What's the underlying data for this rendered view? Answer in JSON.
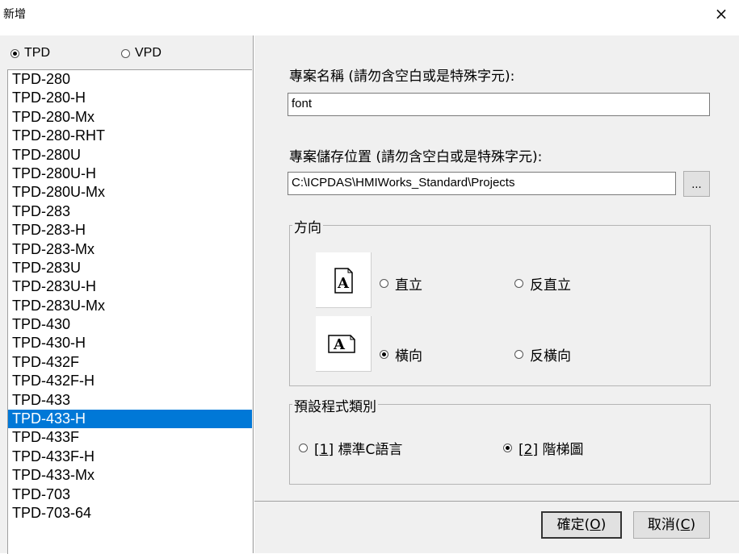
{
  "window": {
    "title": "新增",
    "close_glyph": "×"
  },
  "device_type": {
    "options": [
      {
        "label": "TPD",
        "checked": true
      },
      {
        "label": "VPD",
        "checked": false
      }
    ]
  },
  "model_list": {
    "items": [
      "TPD-280",
      "TPD-280-H",
      "TPD-280-Mx",
      "TPD-280-RHT",
      "TPD-280U",
      "TPD-280U-H",
      "TPD-280U-Mx",
      "TPD-283",
      "TPD-283-H",
      "TPD-283-Mx",
      "TPD-283U",
      "TPD-283U-H",
      "TPD-283U-Mx",
      "TPD-430",
      "TPD-430-H",
      "TPD-432F",
      "TPD-432F-H",
      "TPD-433",
      "TPD-433-H",
      "TPD-433F",
      "TPD-433F-H",
      "TPD-433-Mx",
      "TPD-703",
      "TPD-703-64"
    ],
    "selected": "TPD-433-H"
  },
  "project_name": {
    "label": "專案名稱 (請勿含空白或是特殊字元):",
    "value": "font"
  },
  "project_path": {
    "label": "專案儲存位置 (請勿含空白或是特殊字元):",
    "value": "C:\\ICPDAS\\HMIWorks_Standard\\Projects",
    "browse_label": "..."
  },
  "orientation": {
    "title": "方向",
    "icon_glyph": "A",
    "options": {
      "portrait": "直立",
      "reverse_portrait": "反直立",
      "landscape": "橫向",
      "reverse_landscape": "反橫向"
    },
    "selected": "橫向"
  },
  "program_type": {
    "title": "預設程式類別",
    "options": [
      {
        "key": "[1]",
        "label": " 標準C語言",
        "checked": false
      },
      {
        "key": "[2]",
        "label": " 階梯圖",
        "checked": true
      }
    ]
  },
  "buttons": {
    "ok": {
      "label": "確定(",
      "key": "O",
      "suffix": ")"
    },
    "cancel": {
      "label": "取消(",
      "key": "C",
      "suffix": ")"
    }
  },
  "colors": {
    "selection": "#0078d7",
    "dialog_bg": "#f0f0f0"
  }
}
